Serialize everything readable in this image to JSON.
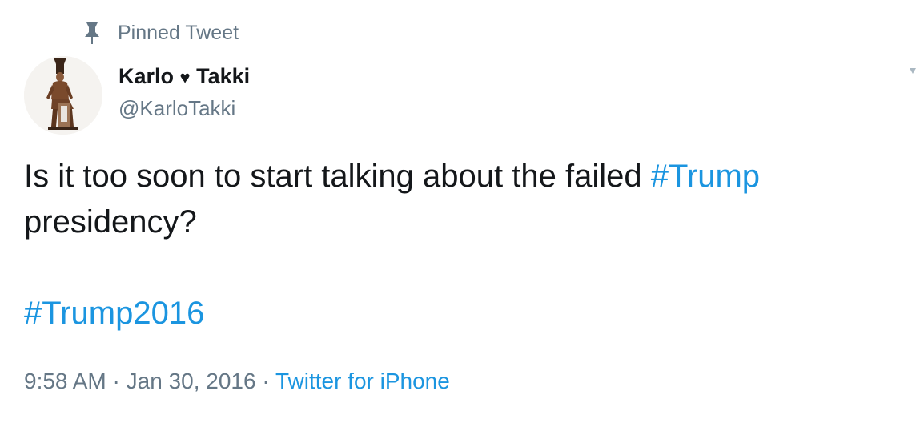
{
  "pinned": {
    "icon": "pin-icon",
    "label": "Pinned Tweet"
  },
  "author": {
    "avatar_icon": "avatar-image",
    "name_first": "Karlo",
    "name_heart": "♥",
    "name_last": "Takki",
    "handle": "@KarloTakki"
  },
  "tweet": {
    "line1_text": "Is it too soon to start talking about the failed ",
    "line1_hashtag": "#Trump",
    "line2_text": "presidency?",
    "hashtag2": "#Trump2016"
  },
  "meta": {
    "time": "9:58 AM",
    "separator1": " · ",
    "date": "Jan 30, 2016",
    "separator2": " · ",
    "source": "Twitter for iPhone"
  },
  "colors": {
    "link": "#1b95e0",
    "text": "#14171a",
    "secondary": "#657786"
  }
}
